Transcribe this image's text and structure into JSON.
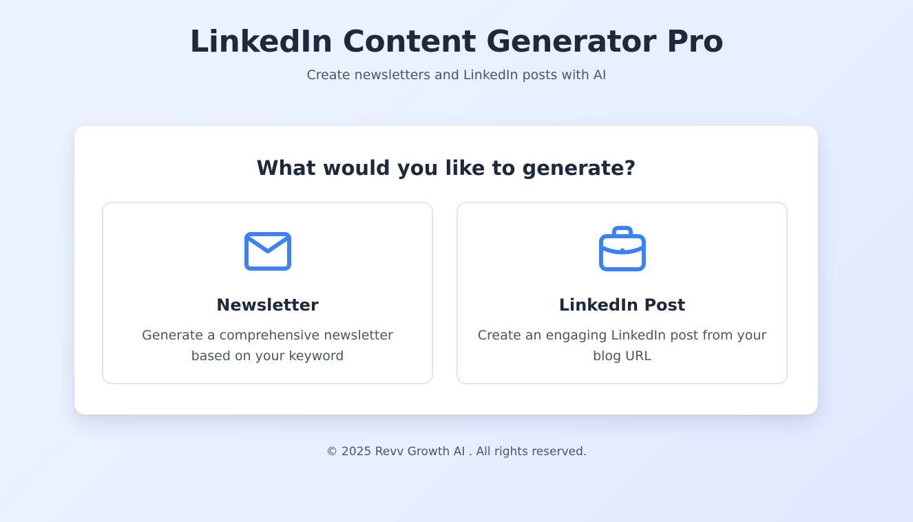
{
  "header": {
    "title": "LinkedIn Content Generator Pro",
    "subtitle": "Create newsletters and LinkedIn posts with AI"
  },
  "card": {
    "heading": "What would you like to generate?",
    "options": [
      {
        "title": "Newsletter",
        "description": "Generate a comprehensive newsletter based on your keyword",
        "icon": "envelope-icon"
      },
      {
        "title": "LinkedIn Post",
        "description": "Create an engaging LinkedIn post from your blog URL",
        "icon": "briefcase-icon"
      }
    ]
  },
  "footer": {
    "text": "© 2025 Revv Growth AI . All rights reserved."
  },
  "colors": {
    "accent": "#3b82f6",
    "background": "#eaf0ff",
    "card": "#ffffff",
    "text_primary": "#1e293b",
    "text_secondary": "#4b5563"
  }
}
